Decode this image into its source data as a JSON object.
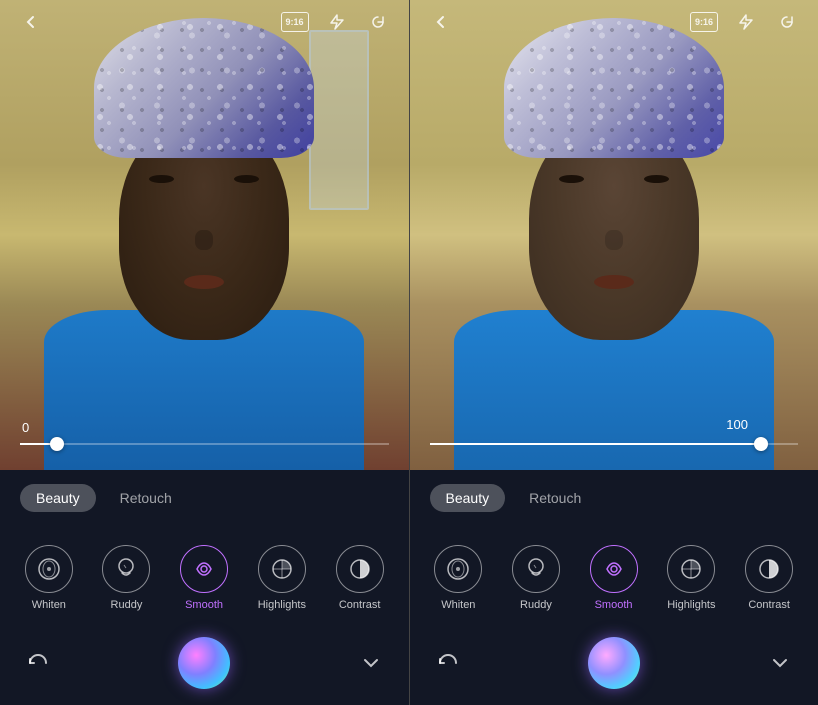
{
  "panels": [
    {
      "id": "left",
      "top_bar": {
        "back_icon": "‹",
        "badge": "9:16",
        "flash_icon": "⚡",
        "rotate_icon": "↻"
      },
      "slider": {
        "value": "0",
        "percent": 10
      },
      "tabs": [
        {
          "label": "Beauty",
          "active": true
        },
        {
          "label": "Retouch",
          "active": false
        }
      ],
      "tools": [
        {
          "name": "Whiten",
          "active": false
        },
        {
          "name": "Ruddy",
          "active": false
        },
        {
          "name": "Smooth",
          "active": true
        },
        {
          "name": "Highlights",
          "active": false
        },
        {
          "name": "Contrast",
          "active": false
        }
      ],
      "bottom": {
        "reset_icon": "↺",
        "chevron_icon": "∨"
      }
    },
    {
      "id": "right",
      "top_bar": {
        "back_icon": "‹",
        "badge": "9:16",
        "flash_icon": "⚡",
        "rotate_icon": "↻"
      },
      "slider": {
        "value": "100",
        "percent": 90
      },
      "tabs": [
        {
          "label": "Beauty",
          "active": true
        },
        {
          "label": "Retouch",
          "active": false
        }
      ],
      "tools": [
        {
          "name": "Whiten",
          "active": false
        },
        {
          "name": "Ruddy",
          "active": false
        },
        {
          "name": "Smooth",
          "active": true
        },
        {
          "name": "Highlights",
          "active": false
        },
        {
          "name": "Contrast",
          "active": false
        }
      ],
      "bottom": {
        "reset_icon": "↺",
        "chevron_icon": "∨"
      }
    }
  ]
}
